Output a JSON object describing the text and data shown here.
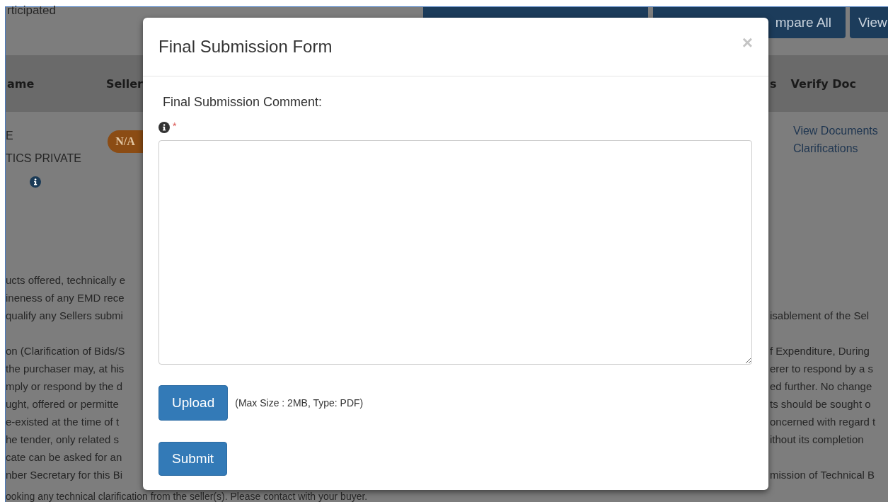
{
  "page": {
    "top_text": "rticipated",
    "toolbar_buttons": [
      {
        "label": "mpare All"
      },
      {
        "label": "View"
      }
    ],
    "table": {
      "left_columns": [
        "ame",
        "Seller"
      ],
      "right_columns": [
        "s",
        "Verify Doc"
      ],
      "row": {
        "name_lines": [
          "E",
          "TICS PRIVATE"
        ],
        "badge": "N/A",
        "links": [
          "View Documents",
          "Clarifications"
        ]
      }
    },
    "paragraphs": [
      {
        "lines": [
          {
            "left": "ucts offered, technically e"
          },
          {
            "left": "ineness of any EMD rece"
          },
          {
            "left": "qualify any Sellers submi",
            "right": "isablement of the Sel"
          }
        ]
      },
      {
        "lines": [
          {
            "left": "on (Clarification of Bids/S",
            "right": "f Expenditure, During"
          },
          {
            "left": "the purchaser may, at his",
            "right": "erer to respond by a s"
          },
          {
            "left": "mply or respond by the d",
            "right": "ed further. No change"
          },
          {
            "left": "ught, offered or permitte",
            "right": "ts should be sought o"
          },
          {
            "left": "e-existed at the time of t",
            "right": "oncerned with regard t"
          },
          {
            "left": "he tender, only related s",
            "right": "ithout its completion"
          },
          {
            "left": "cate can be asked for an"
          },
          {
            "left": "nber Secretary for this Bi",
            "right": "mission of Technical B"
          }
        ]
      }
    ],
    "bottom_line": "ooking any technical clarification from the seller(s). Please contact with your buyer."
  },
  "modal": {
    "title": "Final Submission Form",
    "close": "×",
    "comment_label": "Final Submission Comment:",
    "required_mark": "*",
    "upload_button": "Upload",
    "upload_hint": "(Max Size : 2MB, Type: PDF)",
    "submit_button": "Submit"
  }
}
